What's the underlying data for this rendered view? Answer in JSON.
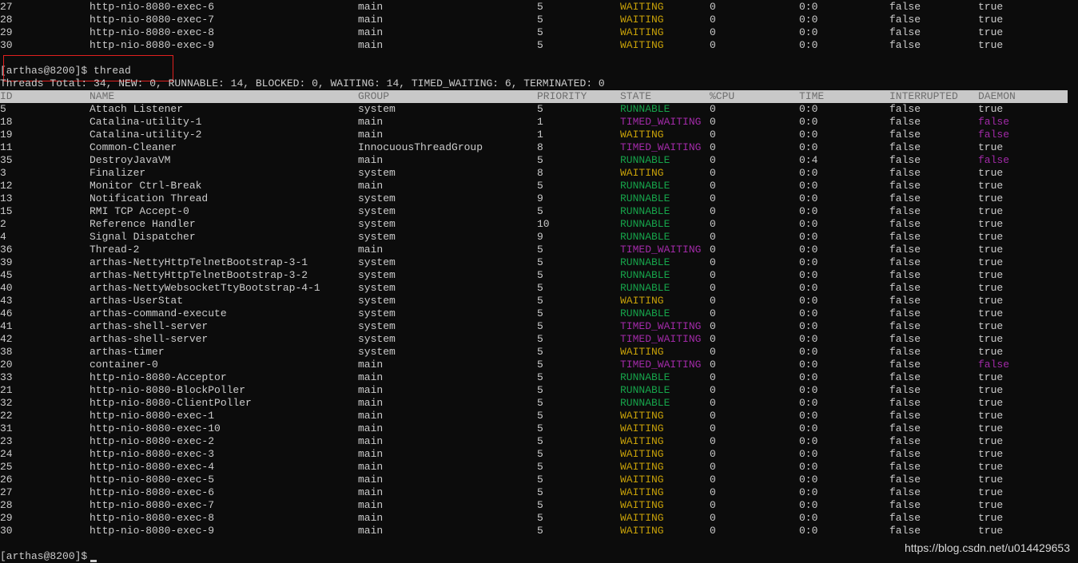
{
  "colors": {
    "background": "#0c0c0c",
    "text": "#cccccc",
    "RUNNABLE": "#16a34a",
    "WAITING": "#c7a008",
    "TIMED_WAITING": "#a22aa8",
    "daemon_false": "#a22aa8",
    "header_bg": "#c8c8c8",
    "header_text": "#6e6e6e",
    "highlight_border": "#e0201f"
  },
  "previous_rows": [
    {
      "id": "27",
      "name": "http-nio-8080-exec-6",
      "group": "main",
      "priority": "5",
      "state": "WAITING",
      "cpu": "0",
      "time": "0:0",
      "interrupted": "false",
      "daemon": "true"
    },
    {
      "id": "28",
      "name": "http-nio-8080-exec-7",
      "group": "main",
      "priority": "5",
      "state": "WAITING",
      "cpu": "0",
      "time": "0:0",
      "interrupted": "false",
      "daemon": "true"
    },
    {
      "id": "29",
      "name": "http-nio-8080-exec-8",
      "group": "main",
      "priority": "5",
      "state": "WAITING",
      "cpu": "0",
      "time": "0:0",
      "interrupted": "false",
      "daemon": "true"
    },
    {
      "id": "30",
      "name": "http-nio-8080-exec-9",
      "group": "main",
      "priority": "5",
      "state": "WAITING",
      "cpu": "0",
      "time": "0:0",
      "interrupted": "false",
      "daemon": "true"
    }
  ],
  "command": {
    "prompt": "[arthas@8200]$",
    "text": "thread"
  },
  "summary": "Threads Total: 34, NEW: 0, RUNNABLE: 14, BLOCKED: 0, WAITING: 14, TIMED_WAITING: 6, TERMINATED: 0",
  "columns": {
    "id": "ID",
    "name": "NAME",
    "group": "GROUP",
    "priority": "PRIORITY",
    "state": "STATE",
    "cpu": "%CPU",
    "time": "TIME",
    "interrupted": "INTERRUPTED",
    "daemon": "DAEMON"
  },
  "threads": [
    {
      "id": "5",
      "name": "Attach Listener",
      "group": "system",
      "priority": "5",
      "state": "RUNNABLE",
      "cpu": "0",
      "time": "0:0",
      "interrupted": "false",
      "daemon": "true"
    },
    {
      "id": "18",
      "name": "Catalina-utility-1",
      "group": "main",
      "priority": "1",
      "state": "TIMED_WAITING",
      "cpu": "0",
      "time": "0:0",
      "interrupted": "false",
      "daemon": "false"
    },
    {
      "id": "19",
      "name": "Catalina-utility-2",
      "group": "main",
      "priority": "1",
      "state": "WAITING",
      "cpu": "0",
      "time": "0:0",
      "interrupted": "false",
      "daemon": "false"
    },
    {
      "id": "11",
      "name": "Common-Cleaner",
      "group": "InnocuousThreadGroup",
      "priority": "8",
      "state": "TIMED_WAITING",
      "cpu": "0",
      "time": "0:0",
      "interrupted": "false",
      "daemon": "true"
    },
    {
      "id": "35",
      "name": "DestroyJavaVM",
      "group": "main",
      "priority": "5",
      "state": "RUNNABLE",
      "cpu": "0",
      "time": "0:4",
      "interrupted": "false",
      "daemon": "false"
    },
    {
      "id": "3",
      "name": "Finalizer",
      "group": "system",
      "priority": "8",
      "state": "WAITING",
      "cpu": "0",
      "time": "0:0",
      "interrupted": "false",
      "daemon": "true"
    },
    {
      "id": "12",
      "name": "Monitor Ctrl-Break",
      "group": "main",
      "priority": "5",
      "state": "RUNNABLE",
      "cpu": "0",
      "time": "0:0",
      "interrupted": "false",
      "daemon": "true"
    },
    {
      "id": "13",
      "name": "Notification Thread",
      "group": "system",
      "priority": "9",
      "state": "RUNNABLE",
      "cpu": "0",
      "time": "0:0",
      "interrupted": "false",
      "daemon": "true"
    },
    {
      "id": "15",
      "name": "RMI TCP Accept-0",
      "group": "system",
      "priority": "5",
      "state": "RUNNABLE",
      "cpu": "0",
      "time": "0:0",
      "interrupted": "false",
      "daemon": "true"
    },
    {
      "id": "2",
      "name": "Reference Handler",
      "group": "system",
      "priority": "10",
      "state": "RUNNABLE",
      "cpu": "0",
      "time": "0:0",
      "interrupted": "false",
      "daemon": "true"
    },
    {
      "id": "4",
      "name": "Signal Dispatcher",
      "group": "system",
      "priority": "9",
      "state": "RUNNABLE",
      "cpu": "0",
      "time": "0:0",
      "interrupted": "false",
      "daemon": "true"
    },
    {
      "id": "36",
      "name": "Thread-2",
      "group": "main",
      "priority": "5",
      "state": "TIMED_WAITING",
      "cpu": "0",
      "time": "0:0",
      "interrupted": "false",
      "daemon": "true"
    },
    {
      "id": "39",
      "name": "arthas-NettyHttpTelnetBootstrap-3-1",
      "group": "system",
      "priority": "5",
      "state": "RUNNABLE",
      "cpu": "0",
      "time": "0:0",
      "interrupted": "false",
      "daemon": "true"
    },
    {
      "id": "45",
      "name": "arthas-NettyHttpTelnetBootstrap-3-2",
      "group": "system",
      "priority": "5",
      "state": "RUNNABLE",
      "cpu": "0",
      "time": "0:0",
      "interrupted": "false",
      "daemon": "true"
    },
    {
      "id": "40",
      "name": "arthas-NettyWebsocketTtyBootstrap-4-1",
      "group": "system",
      "priority": "5",
      "state": "RUNNABLE",
      "cpu": "0",
      "time": "0:0",
      "interrupted": "false",
      "daemon": "true"
    },
    {
      "id": "43",
      "name": "arthas-UserStat",
      "group": "system",
      "priority": "5",
      "state": "WAITING",
      "cpu": "0",
      "time": "0:0",
      "interrupted": "false",
      "daemon": "true"
    },
    {
      "id": "46",
      "name": "arthas-command-execute",
      "group": "system",
      "priority": "5",
      "state": "RUNNABLE",
      "cpu": "0",
      "time": "0:0",
      "interrupted": "false",
      "daemon": "true"
    },
    {
      "id": "41",
      "name": "arthas-shell-server",
      "group": "system",
      "priority": "5",
      "state": "TIMED_WAITING",
      "cpu": "0",
      "time": "0:0",
      "interrupted": "false",
      "daemon": "true"
    },
    {
      "id": "42",
      "name": "arthas-shell-server",
      "group": "system",
      "priority": "5",
      "state": "TIMED_WAITING",
      "cpu": "0",
      "time": "0:0",
      "interrupted": "false",
      "daemon": "true"
    },
    {
      "id": "38",
      "name": "arthas-timer",
      "group": "system",
      "priority": "5",
      "state": "WAITING",
      "cpu": "0",
      "time": "0:0",
      "interrupted": "false",
      "daemon": "true"
    },
    {
      "id": "20",
      "name": "container-0",
      "group": "main",
      "priority": "5",
      "state": "TIMED_WAITING",
      "cpu": "0",
      "time": "0:0",
      "interrupted": "false",
      "daemon": "false"
    },
    {
      "id": "33",
      "name": "http-nio-8080-Acceptor",
      "group": "main",
      "priority": "5",
      "state": "RUNNABLE",
      "cpu": "0",
      "time": "0:0",
      "interrupted": "false",
      "daemon": "true"
    },
    {
      "id": "21",
      "name": "http-nio-8080-BlockPoller",
      "group": "main",
      "priority": "5",
      "state": "RUNNABLE",
      "cpu": "0",
      "time": "0:0",
      "interrupted": "false",
      "daemon": "true"
    },
    {
      "id": "32",
      "name": "http-nio-8080-ClientPoller",
      "group": "main",
      "priority": "5",
      "state": "RUNNABLE",
      "cpu": "0",
      "time": "0:0",
      "interrupted": "false",
      "daemon": "true"
    },
    {
      "id": "22",
      "name": "http-nio-8080-exec-1",
      "group": "main",
      "priority": "5",
      "state": "WAITING",
      "cpu": "0",
      "time": "0:0",
      "interrupted": "false",
      "daemon": "true"
    },
    {
      "id": "31",
      "name": "http-nio-8080-exec-10",
      "group": "main",
      "priority": "5",
      "state": "WAITING",
      "cpu": "0",
      "time": "0:0",
      "interrupted": "false",
      "daemon": "true"
    },
    {
      "id": "23",
      "name": "http-nio-8080-exec-2",
      "group": "main",
      "priority": "5",
      "state": "WAITING",
      "cpu": "0",
      "time": "0:0",
      "interrupted": "false",
      "daemon": "true"
    },
    {
      "id": "24",
      "name": "http-nio-8080-exec-3",
      "group": "main",
      "priority": "5",
      "state": "WAITING",
      "cpu": "0",
      "time": "0:0",
      "interrupted": "false",
      "daemon": "true"
    },
    {
      "id": "25",
      "name": "http-nio-8080-exec-4",
      "group": "main",
      "priority": "5",
      "state": "WAITING",
      "cpu": "0",
      "time": "0:0",
      "interrupted": "false",
      "daemon": "true"
    },
    {
      "id": "26",
      "name": "http-nio-8080-exec-5",
      "group": "main",
      "priority": "5",
      "state": "WAITING",
      "cpu": "0",
      "time": "0:0",
      "interrupted": "false",
      "daemon": "true"
    },
    {
      "id": "27",
      "name": "http-nio-8080-exec-6",
      "group": "main",
      "priority": "5",
      "state": "WAITING",
      "cpu": "0",
      "time": "0:0",
      "interrupted": "false",
      "daemon": "true"
    },
    {
      "id": "28",
      "name": "http-nio-8080-exec-7",
      "group": "main",
      "priority": "5",
      "state": "WAITING",
      "cpu": "0",
      "time": "0:0",
      "interrupted": "false",
      "daemon": "true"
    },
    {
      "id": "29",
      "name": "http-nio-8080-exec-8",
      "group": "main",
      "priority": "5",
      "state": "WAITING",
      "cpu": "0",
      "time": "0:0",
      "interrupted": "false",
      "daemon": "true"
    },
    {
      "id": "30",
      "name": "http-nio-8080-exec-9",
      "group": "main",
      "priority": "5",
      "state": "WAITING",
      "cpu": "0",
      "time": "0:0",
      "interrupted": "false",
      "daemon": "true"
    }
  ],
  "final_prompt": "[arthas@8200]$",
  "watermark": "https://blog.csdn.net/u014429653"
}
